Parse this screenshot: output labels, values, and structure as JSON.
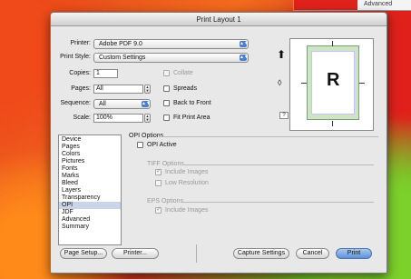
{
  "background": {
    "corner_label": "Advanced"
  },
  "window": {
    "title": "Print Layout 1"
  },
  "printer": {
    "label": "Printer:",
    "value": "Adobe PDF 9.0"
  },
  "print_style": {
    "label": "Print Style:",
    "value": "Custom Settings"
  },
  "copies": {
    "label": "Copies:",
    "value": "1"
  },
  "pages": {
    "label": "Pages:",
    "value": "All"
  },
  "sequence": {
    "label": "Sequence:",
    "value": "All"
  },
  "scale": {
    "label": "Scale:",
    "value": "100%"
  },
  "options": {
    "collate": "Collate",
    "spreads": "Spreads",
    "back_to_front": "Back to Front",
    "fit_print_area": "Fit Print Area"
  },
  "preview": {
    "letter": "R",
    "info_label": "?"
  },
  "sidebar": {
    "items": [
      "Device",
      "Pages",
      "Colors",
      "Pictures",
      "Fonts",
      "Marks",
      "Bleed",
      "Layers",
      "Transparency",
      "OPI",
      "JDF",
      "Advanced",
      "Summary"
    ],
    "selected": "OPI"
  },
  "opi": {
    "section_title": "OPI Options",
    "opi_active": "OPI Active",
    "tiff_title": "TIFF Options",
    "tiff_include_images": "Include Images",
    "tiff_low_resolution": "Low Resolution",
    "eps_title": "EPS Options",
    "eps_include_images": "Include Images"
  },
  "buttons": {
    "page_setup": "Page Setup...",
    "printer": "Printer...",
    "capture_settings": "Capture Settings",
    "cancel": "Cancel",
    "print": "Print"
  },
  "colors": {
    "accent": "#4a7fd1",
    "selection": "#c9d6ea"
  }
}
